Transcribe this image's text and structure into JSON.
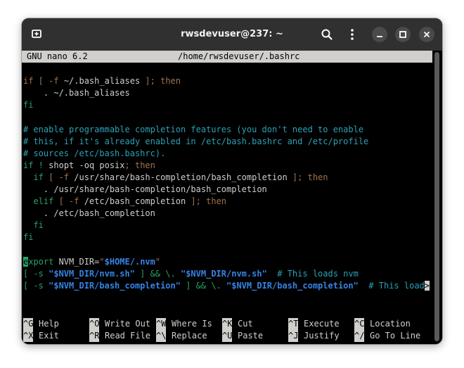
{
  "window": {
    "title": "rwsdevuser@237: ~",
    "icons": {
      "new_tab": "new-tab-icon",
      "search": "search-icon",
      "menu": "kebab-menu-icon",
      "minimize": "minimize-icon",
      "maximize": "maximize-icon",
      "close": "close-icon"
    }
  },
  "nano": {
    "version": "GNU nano 6.2",
    "file": "/home/rwsdevuser/.bashrc"
  },
  "code": {
    "l1": {
      "a": "if",
      "b": " [ -f ",
      "c": "~/.bash_aliases",
      "d": " ]; ",
      "e": "then"
    },
    "l2": {
      "a": "    . ~/.bash_aliases"
    },
    "l3": {
      "a": "fi"
    },
    "l4": {
      "a": "# enable programmable completion features (you don't need to enable"
    },
    "l5": {
      "a": "# this, if it's already enabled in /etc/bash.bashrc and /etc/profile"
    },
    "l6": {
      "a": "# sources /etc/bash.bashrc)."
    },
    "l7": {
      "a": "if",
      "b": " ! ",
      "c": "shopt -oq posix",
      "d": "; ",
      "e": "then"
    },
    "l8": {
      "a": "  if",
      "b": " [ -f ",
      "c": "/usr/share/bash-completion/bash_completion",
      "d": " ]; ",
      "e": "then"
    },
    "l9": {
      "a": "    . /usr/share/bash-completion/bash_completion"
    },
    "l10": {
      "a": "  elif",
      "b": " [ -f ",
      "c": "/etc/bash_completion",
      "d": " ]; ",
      "e": "then"
    },
    "l11": {
      "a": "    . /etc/bash_completion"
    },
    "l12": {
      "a": "  fi"
    },
    "l13": {
      "a": "fi"
    },
    "l14": {
      "cursor": "e",
      "a": "xport",
      "b": " NVM_DIR=",
      "c": "\"",
      "d": "$HOME/.nvm",
      "e": "\""
    },
    "l15": {
      "a": "[ -s ",
      "b": "\"$NVM_DIR/nvm.sh\"",
      "c": " ] && \\. ",
      "d": "\"$NVM_DIR/nvm.sh\"",
      "e": "  # This loads nvm"
    },
    "l16": {
      "a": "[ -s ",
      "b": "\"$NVM_DIR/bash_completion\"",
      "c": " ] && \\. ",
      "d": "\"$NVM_DIR/bash_completion\"",
      "e": "  # This load",
      "f": ">"
    }
  },
  "shortcuts": [
    {
      "key": "^G",
      "label": "Help"
    },
    {
      "key": "^O",
      "label": "Write Out"
    },
    {
      "key": "^W",
      "label": "Where Is"
    },
    {
      "key": "^K",
      "label": "Cut"
    },
    {
      "key": "^T",
      "label": "Execute"
    },
    {
      "key": "^C",
      "label": "Location"
    },
    {
      "key": "^X",
      "label": "Exit"
    },
    {
      "key": "^R",
      "label": "Read File"
    },
    {
      "key": "^\\",
      "label": "Replace"
    },
    {
      "key": "^U",
      "label": "Paste"
    },
    {
      "key": "^J",
      "label": "Justify"
    },
    {
      "key": "^/",
      "label": "Go To Line"
    }
  ]
}
